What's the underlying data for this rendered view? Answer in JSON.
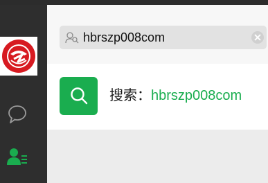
{
  "search": {
    "value": "hbrszp008com",
    "icon": "person-search-icon",
    "clear_icon": "close-icon"
  },
  "result": {
    "prefix": "搜索：",
    "query": "hbrszp008com",
    "icon": "search-icon"
  },
  "sidebar": {
    "items": [
      {
        "name": "chat",
        "icon": "chat-bubble-icon"
      },
      {
        "name": "contacts",
        "icon": "contacts-icon",
        "active": true
      }
    ]
  },
  "colors": {
    "accent": "#1aad4f",
    "sidebar_bg": "#2e2e2e",
    "logo_red": "#d71a21"
  }
}
